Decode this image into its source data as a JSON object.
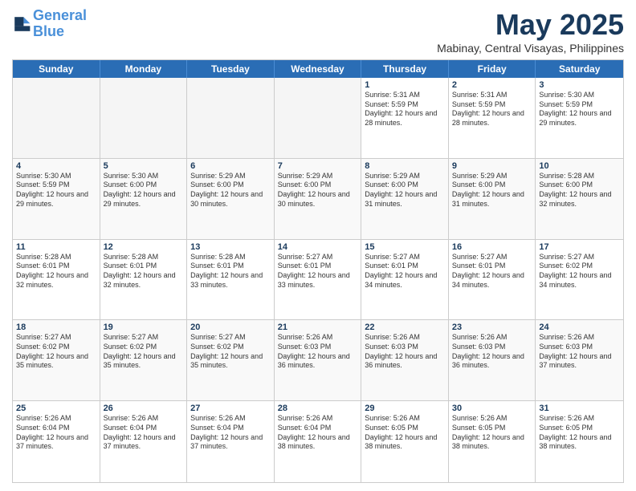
{
  "header": {
    "logo_line1": "General",
    "logo_line2": "Blue",
    "month": "May 2025",
    "location": "Mabinay, Central Visayas, Philippines"
  },
  "weekdays": [
    "Sunday",
    "Monday",
    "Tuesday",
    "Wednesday",
    "Thursday",
    "Friday",
    "Saturday"
  ],
  "weeks": [
    [
      {
        "day": "",
        "sunrise": "",
        "sunset": "",
        "daylight": "",
        "empty": true
      },
      {
        "day": "",
        "sunrise": "",
        "sunset": "",
        "daylight": "",
        "empty": true
      },
      {
        "day": "",
        "sunrise": "",
        "sunset": "",
        "daylight": "",
        "empty": true
      },
      {
        "day": "",
        "sunrise": "",
        "sunset": "",
        "daylight": "",
        "empty": true
      },
      {
        "day": "1",
        "sunrise": "Sunrise: 5:31 AM",
        "sunset": "Sunset: 5:59 PM",
        "daylight": "Daylight: 12 hours and 28 minutes."
      },
      {
        "day": "2",
        "sunrise": "Sunrise: 5:31 AM",
        "sunset": "Sunset: 5:59 PM",
        "daylight": "Daylight: 12 hours and 28 minutes."
      },
      {
        "day": "3",
        "sunrise": "Sunrise: 5:30 AM",
        "sunset": "Sunset: 5:59 PM",
        "daylight": "Daylight: 12 hours and 29 minutes."
      }
    ],
    [
      {
        "day": "4",
        "sunrise": "Sunrise: 5:30 AM",
        "sunset": "Sunset: 5:59 PM",
        "daylight": "Daylight: 12 hours and 29 minutes."
      },
      {
        "day": "5",
        "sunrise": "Sunrise: 5:30 AM",
        "sunset": "Sunset: 6:00 PM",
        "daylight": "Daylight: 12 hours and 29 minutes."
      },
      {
        "day": "6",
        "sunrise": "Sunrise: 5:29 AM",
        "sunset": "Sunset: 6:00 PM",
        "daylight": "Daylight: 12 hours and 30 minutes."
      },
      {
        "day": "7",
        "sunrise": "Sunrise: 5:29 AM",
        "sunset": "Sunset: 6:00 PM",
        "daylight": "Daylight: 12 hours and 30 minutes."
      },
      {
        "day": "8",
        "sunrise": "Sunrise: 5:29 AM",
        "sunset": "Sunset: 6:00 PM",
        "daylight": "Daylight: 12 hours and 31 minutes."
      },
      {
        "day": "9",
        "sunrise": "Sunrise: 5:29 AM",
        "sunset": "Sunset: 6:00 PM",
        "daylight": "Daylight: 12 hours and 31 minutes."
      },
      {
        "day": "10",
        "sunrise": "Sunrise: 5:28 AM",
        "sunset": "Sunset: 6:00 PM",
        "daylight": "Daylight: 12 hours and 32 minutes."
      }
    ],
    [
      {
        "day": "11",
        "sunrise": "Sunrise: 5:28 AM",
        "sunset": "Sunset: 6:01 PM",
        "daylight": "Daylight: 12 hours and 32 minutes."
      },
      {
        "day": "12",
        "sunrise": "Sunrise: 5:28 AM",
        "sunset": "Sunset: 6:01 PM",
        "daylight": "Daylight: 12 hours and 32 minutes."
      },
      {
        "day": "13",
        "sunrise": "Sunrise: 5:28 AM",
        "sunset": "Sunset: 6:01 PM",
        "daylight": "Daylight: 12 hours and 33 minutes."
      },
      {
        "day": "14",
        "sunrise": "Sunrise: 5:27 AM",
        "sunset": "Sunset: 6:01 PM",
        "daylight": "Daylight: 12 hours and 33 minutes."
      },
      {
        "day": "15",
        "sunrise": "Sunrise: 5:27 AM",
        "sunset": "Sunset: 6:01 PM",
        "daylight": "Daylight: 12 hours and 34 minutes."
      },
      {
        "day": "16",
        "sunrise": "Sunrise: 5:27 AM",
        "sunset": "Sunset: 6:01 PM",
        "daylight": "Daylight: 12 hours and 34 minutes."
      },
      {
        "day": "17",
        "sunrise": "Sunrise: 5:27 AM",
        "sunset": "Sunset: 6:02 PM",
        "daylight": "Daylight: 12 hours and 34 minutes."
      }
    ],
    [
      {
        "day": "18",
        "sunrise": "Sunrise: 5:27 AM",
        "sunset": "Sunset: 6:02 PM",
        "daylight": "Daylight: 12 hours and 35 minutes."
      },
      {
        "day": "19",
        "sunrise": "Sunrise: 5:27 AM",
        "sunset": "Sunset: 6:02 PM",
        "daylight": "Daylight: 12 hours and 35 minutes."
      },
      {
        "day": "20",
        "sunrise": "Sunrise: 5:27 AM",
        "sunset": "Sunset: 6:02 PM",
        "daylight": "Daylight: 12 hours and 35 minutes."
      },
      {
        "day": "21",
        "sunrise": "Sunrise: 5:26 AM",
        "sunset": "Sunset: 6:03 PM",
        "daylight": "Daylight: 12 hours and 36 minutes."
      },
      {
        "day": "22",
        "sunrise": "Sunrise: 5:26 AM",
        "sunset": "Sunset: 6:03 PM",
        "daylight": "Daylight: 12 hours and 36 minutes."
      },
      {
        "day": "23",
        "sunrise": "Sunrise: 5:26 AM",
        "sunset": "Sunset: 6:03 PM",
        "daylight": "Daylight: 12 hours and 36 minutes."
      },
      {
        "day": "24",
        "sunrise": "Sunrise: 5:26 AM",
        "sunset": "Sunset: 6:03 PM",
        "daylight": "Daylight: 12 hours and 37 minutes."
      }
    ],
    [
      {
        "day": "25",
        "sunrise": "Sunrise: 5:26 AM",
        "sunset": "Sunset: 6:04 PM",
        "daylight": "Daylight: 12 hours and 37 minutes."
      },
      {
        "day": "26",
        "sunrise": "Sunrise: 5:26 AM",
        "sunset": "Sunset: 6:04 PM",
        "daylight": "Daylight: 12 hours and 37 minutes."
      },
      {
        "day": "27",
        "sunrise": "Sunrise: 5:26 AM",
        "sunset": "Sunset: 6:04 PM",
        "daylight": "Daylight: 12 hours and 37 minutes."
      },
      {
        "day": "28",
        "sunrise": "Sunrise: 5:26 AM",
        "sunset": "Sunset: 6:04 PM",
        "daylight": "Daylight: 12 hours and 38 minutes."
      },
      {
        "day": "29",
        "sunrise": "Sunrise: 5:26 AM",
        "sunset": "Sunset: 6:05 PM",
        "daylight": "Daylight: 12 hours and 38 minutes."
      },
      {
        "day": "30",
        "sunrise": "Sunrise: 5:26 AM",
        "sunset": "Sunset: 6:05 PM",
        "daylight": "Daylight: 12 hours and 38 minutes."
      },
      {
        "day": "31",
        "sunrise": "Sunrise: 5:26 AM",
        "sunset": "Sunset: 6:05 PM",
        "daylight": "Daylight: 12 hours and 38 minutes."
      }
    ]
  ]
}
